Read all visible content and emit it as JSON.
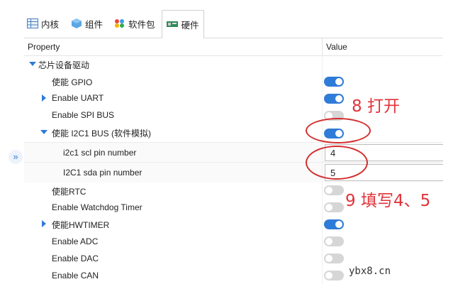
{
  "tabs": [
    {
      "label": "内核",
      "icon": "table-icon",
      "active": false
    },
    {
      "label": "组件",
      "icon": "cube-icon",
      "active": false
    },
    {
      "label": "软件包",
      "icon": "palette-icon",
      "active": false
    },
    {
      "label": "硬件",
      "icon": "board-icon",
      "active": true
    }
  ],
  "grid": {
    "header_property": "Property",
    "header_value": "Value"
  },
  "rows": [
    {
      "label": "芯片设备驱动",
      "type": "group"
    },
    {
      "label": "使能 GPIO",
      "value": "on"
    },
    {
      "label": "Enable UART",
      "value": "on"
    },
    {
      "label": "Enable SPI BUS",
      "value": "off"
    },
    {
      "label": "使能 I2C1 BUS (软件模拟)",
      "value": "on"
    },
    {
      "label": "i2c1 scl pin number",
      "value": "4"
    },
    {
      "label": "I2C1 sda pin number",
      "value": "5"
    },
    {
      "label": "使能RTC",
      "value": "off"
    },
    {
      "label": "Enable Watchdog Timer",
      "value": "off"
    },
    {
      "label": "使能HWTIMER",
      "value": "on"
    },
    {
      "label": "Enable ADC",
      "value": "off"
    },
    {
      "label": "Enable DAC",
      "value": "off"
    },
    {
      "label": "Enable CAN",
      "value": "off"
    }
  ],
  "annotations": {
    "step8": "8 打开",
    "step9": "9 填写4、5"
  },
  "watermark": "ybx8.cn",
  "colors": {
    "accent": "#2f7bd8",
    "annotation": "#e1333a",
    "toggle_off": "#d6d6d6"
  }
}
